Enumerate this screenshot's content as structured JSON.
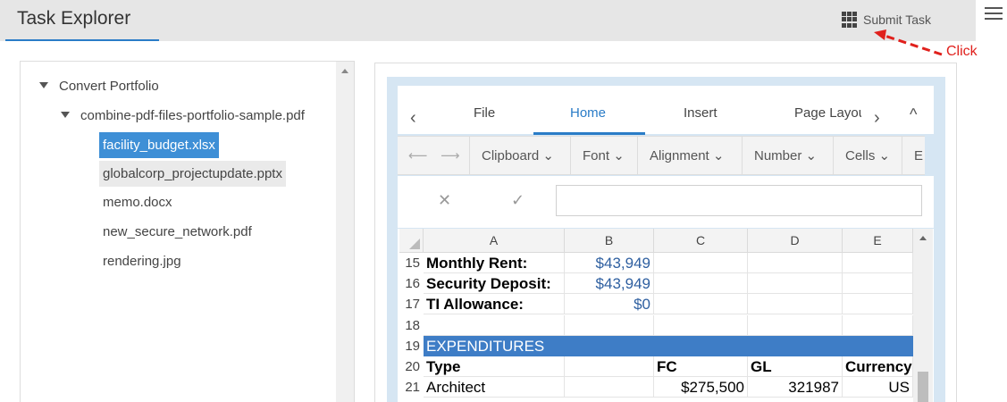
{
  "app": {
    "title": "Task Explorer"
  },
  "header": {
    "submit_label": "Submit Task"
  },
  "annotation": {
    "click_label": "Click",
    "color": "#e0201c"
  },
  "tree": {
    "root": "Convert Portfolio",
    "folder": "combine-pdf-files-portfolio-sample.pdf",
    "files": [
      {
        "name": "facility_budget.xlsx",
        "state": "selected"
      },
      {
        "name": "globalcorp_projectupdate.pptx",
        "state": "hover"
      },
      {
        "name": "memo.docx",
        "state": ""
      },
      {
        "name": "new_secure_network.pdf",
        "state": ""
      },
      {
        "name": "rendering.jpg",
        "state": ""
      }
    ]
  },
  "excel": {
    "tabs": [
      "File",
      "Home",
      "Insert",
      "Page Layou"
    ],
    "active_tab": "Home",
    "nav_prev": "‹",
    "nav_next": "›",
    "collapse": "^",
    "groups": [
      "Clipboard",
      "Font",
      "Alignment",
      "Number",
      "Cells",
      "E"
    ],
    "formula_cancel": "✕",
    "formula_confirm": "✓",
    "columns": [
      "A",
      "B",
      "C",
      "D",
      "E"
    ],
    "rows": [
      {
        "num": "15",
        "a": "Monthly Rent:",
        "b": "$43,949",
        "c": "",
        "d": "",
        "e": ""
      },
      {
        "num": "16",
        "a": "Security Deposit:",
        "b": "$43,949",
        "c": "",
        "d": "",
        "e": ""
      },
      {
        "num": "17",
        "a": "TI Allowance:",
        "b": "$0",
        "c": "",
        "d": "",
        "e": ""
      },
      {
        "num": "18",
        "a": "",
        "b": "",
        "c": "",
        "d": "",
        "e": ""
      },
      {
        "num": "19",
        "a": "EXPENDITURES",
        "b": "",
        "c": "",
        "d": "",
        "e": ""
      },
      {
        "num": "20",
        "a": "Type",
        "b": "",
        "c": "FC",
        "d": "GL",
        "e": "Currency"
      },
      {
        "num": "21",
        "a": "Architect",
        "b": "",
        "c": "$275,500",
        "d": "321987",
        "e": "US"
      }
    ],
    "accent": "#2a7cc7",
    "band_color": "#3e7dc6"
  }
}
